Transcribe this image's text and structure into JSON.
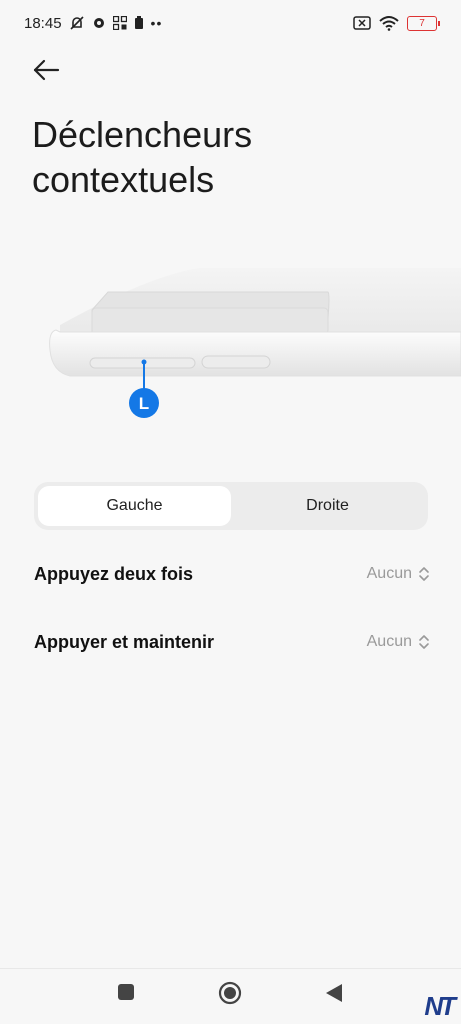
{
  "status_bar": {
    "time": "18:45",
    "battery_level": "7",
    "icons": [
      "mute-icon",
      "gear-icon",
      "apps-icon",
      "battery-saver-icon",
      "more-dots-icon",
      "sim-error-icon",
      "wifi-icon",
      "battery-icon"
    ]
  },
  "header": {
    "title": "Déclencheurs contextuels"
  },
  "illustration": {
    "marker_label": "L"
  },
  "tabs": [
    {
      "label": "Gauche",
      "active": true
    },
    {
      "label": "Droite",
      "active": false
    }
  ],
  "settings": [
    {
      "label": "Appuyez deux fois",
      "value": "Aucun"
    },
    {
      "label": "Appuyer et maintenir",
      "value": "Aucun"
    }
  ],
  "watermark": "NT",
  "colors": {
    "background": "#f7f7f7",
    "accent": "#1478e6",
    "battery_low": "#dd3333"
  }
}
